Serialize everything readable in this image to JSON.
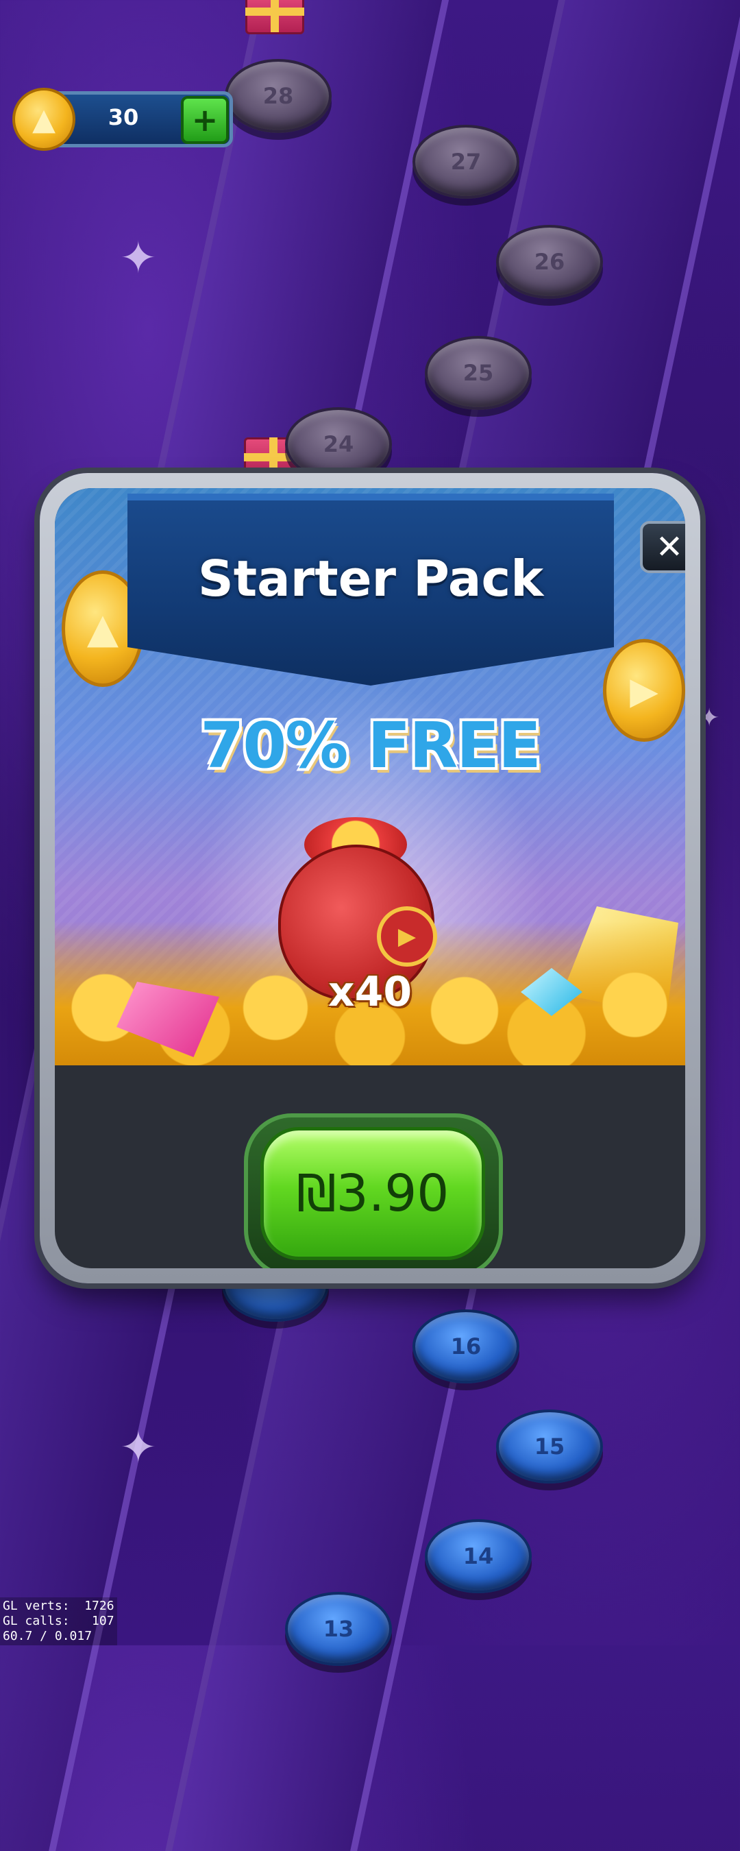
{
  "hud": {
    "coin_count": "30",
    "coin_icon": "coin-icon",
    "add_icon": "plus-icon"
  },
  "map": {
    "nodes_top": [
      {
        "number": "28",
        "state": "locked"
      },
      {
        "number": "27",
        "state": "locked"
      },
      {
        "number": "26",
        "state": "locked"
      },
      {
        "number": "25",
        "state": "locked"
      },
      {
        "number": "24",
        "state": "locked"
      }
    ],
    "nodes_bottom": [
      {
        "number": "16",
        "state": "open"
      },
      {
        "number": "15",
        "state": "open"
      },
      {
        "number": "14",
        "state": "open"
      },
      {
        "number": "13",
        "state": "open"
      }
    ]
  },
  "modal": {
    "title": "Starter Pack",
    "promo": "70% FREE",
    "quantity": "x40",
    "price": "₪3.90",
    "close_glyph": "✕"
  },
  "debug": {
    "line1": "GL verts:  1726",
    "line2": "GL calls:   107",
    "line3": "60.7 / 0.017"
  },
  "colors": {
    "background": "#2e1066",
    "price_button": "#62d821",
    "banner": "#123a74",
    "promo_text": "#2fa6e8"
  }
}
